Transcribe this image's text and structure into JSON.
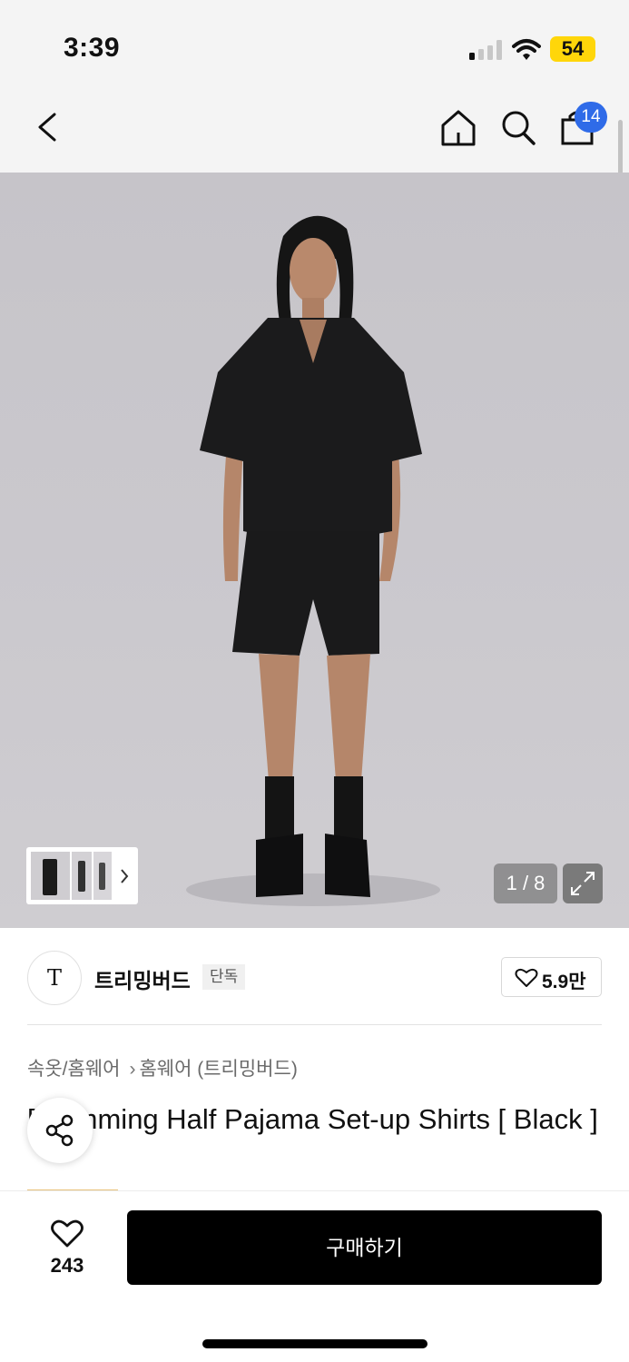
{
  "status_bar": {
    "time": "3:39",
    "battery": "54",
    "icons": [
      "signal-icon",
      "wifi-icon"
    ]
  },
  "header": {
    "bag_count": "14",
    "icons": [
      "back-arrow-icon",
      "home-icon",
      "search-icon",
      "shopping-bag-icon"
    ],
    "accent_color": "#2f6be8"
  },
  "gallery": {
    "pager": "1 / 8",
    "icons": [
      "chevron-right-icon",
      "expand-icon"
    ]
  },
  "brand": {
    "logo": "T",
    "name": "트리밍버드",
    "tag": "단독",
    "likes": "5.9만"
  },
  "product": {
    "category": [
      "속옷/홈웨어",
      "홈웨어 (트리밍버드)"
    ],
    "title": "[ Trimming Half Pajama Set-up Shirts [ Black ]"
  },
  "bottom_bar": {
    "wishlist_count": "243",
    "buy_label": "구매하기"
  }
}
